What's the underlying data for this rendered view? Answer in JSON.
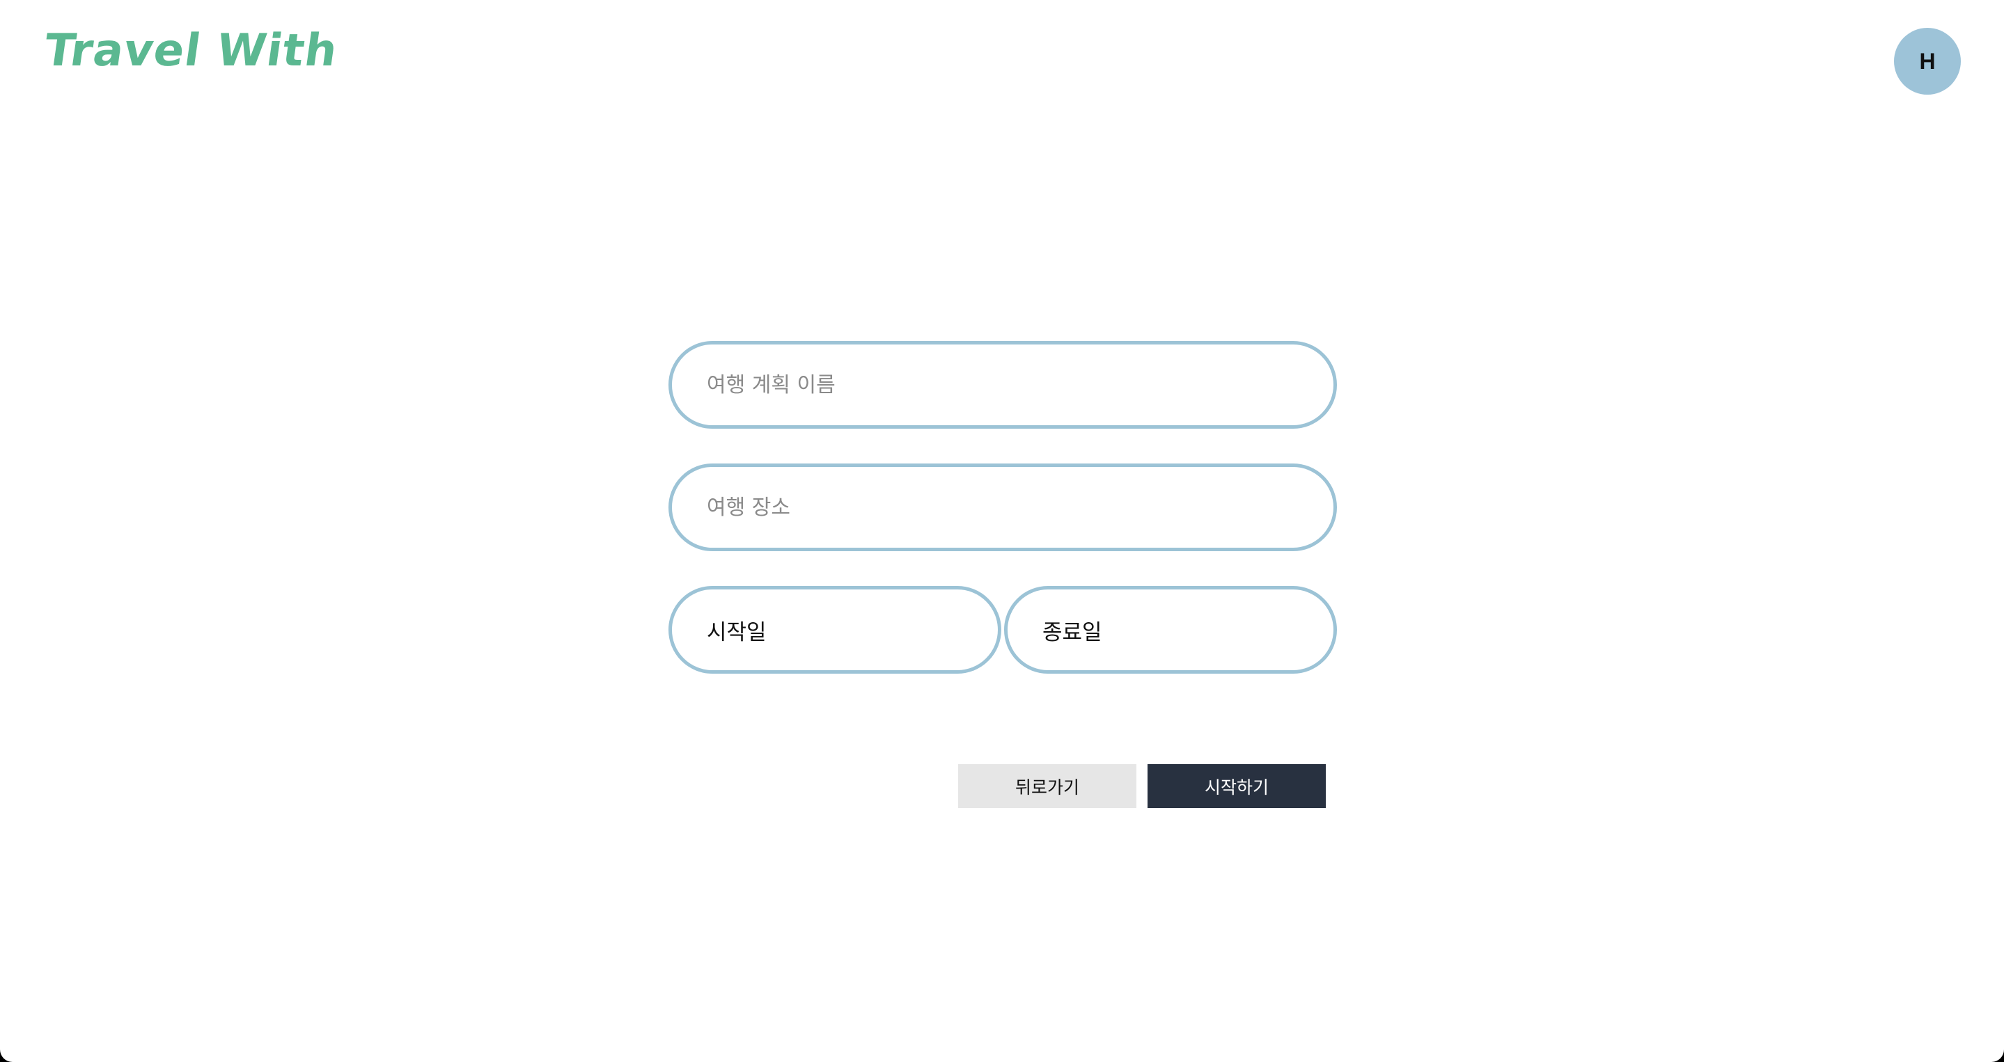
{
  "header": {
    "logo_text": "Travel With",
    "avatar_initial": "H"
  },
  "form": {
    "plan_name": {
      "placeholder": "여행 계획 이름",
      "value": ""
    },
    "place": {
      "placeholder": "여행 장소",
      "value": ""
    },
    "start_date_label": "시작일",
    "end_date_label": "종료일"
  },
  "actions": {
    "back_label": "뒤로가기",
    "start_label": "시작하기"
  },
  "colors": {
    "logo": "#5bb891",
    "avatar_bg": "#9dc3d8",
    "field_border": "#9cc3d6",
    "back_bg": "#e6e6e6",
    "back_text": "#111111",
    "start_bg": "#283140",
    "start_text": "#ffffff"
  }
}
